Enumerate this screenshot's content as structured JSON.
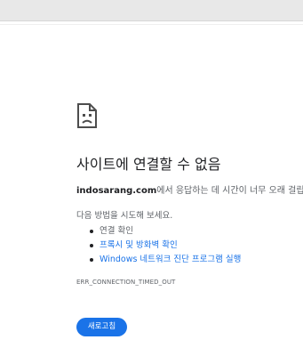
{
  "error_page": {
    "title": "사이트에 연결할 수 없음",
    "host": "indosarang.com",
    "description_rest": "에서 응답하는 데 시간이 너무 오래 걸립니다.",
    "try_text": "다음 방법을 시도해 보세요.",
    "suggestions": [
      {
        "label": "연결 확인",
        "is_link": false
      },
      {
        "label": "프록시 및 방화벽 확인",
        "is_link": true
      },
      {
        "label": "Windows 네트워크 진단 프로그램 실행",
        "is_link": true
      }
    ],
    "error_code": "ERR_CONNECTION_TIMED_OUT",
    "reload_label": "새로고침",
    "icon": "sad-document-icon",
    "colors": {
      "link": "#1a73e8",
      "button": "#1a73e8",
      "text": "#202124",
      "secondary_text": "#5f6368"
    }
  }
}
